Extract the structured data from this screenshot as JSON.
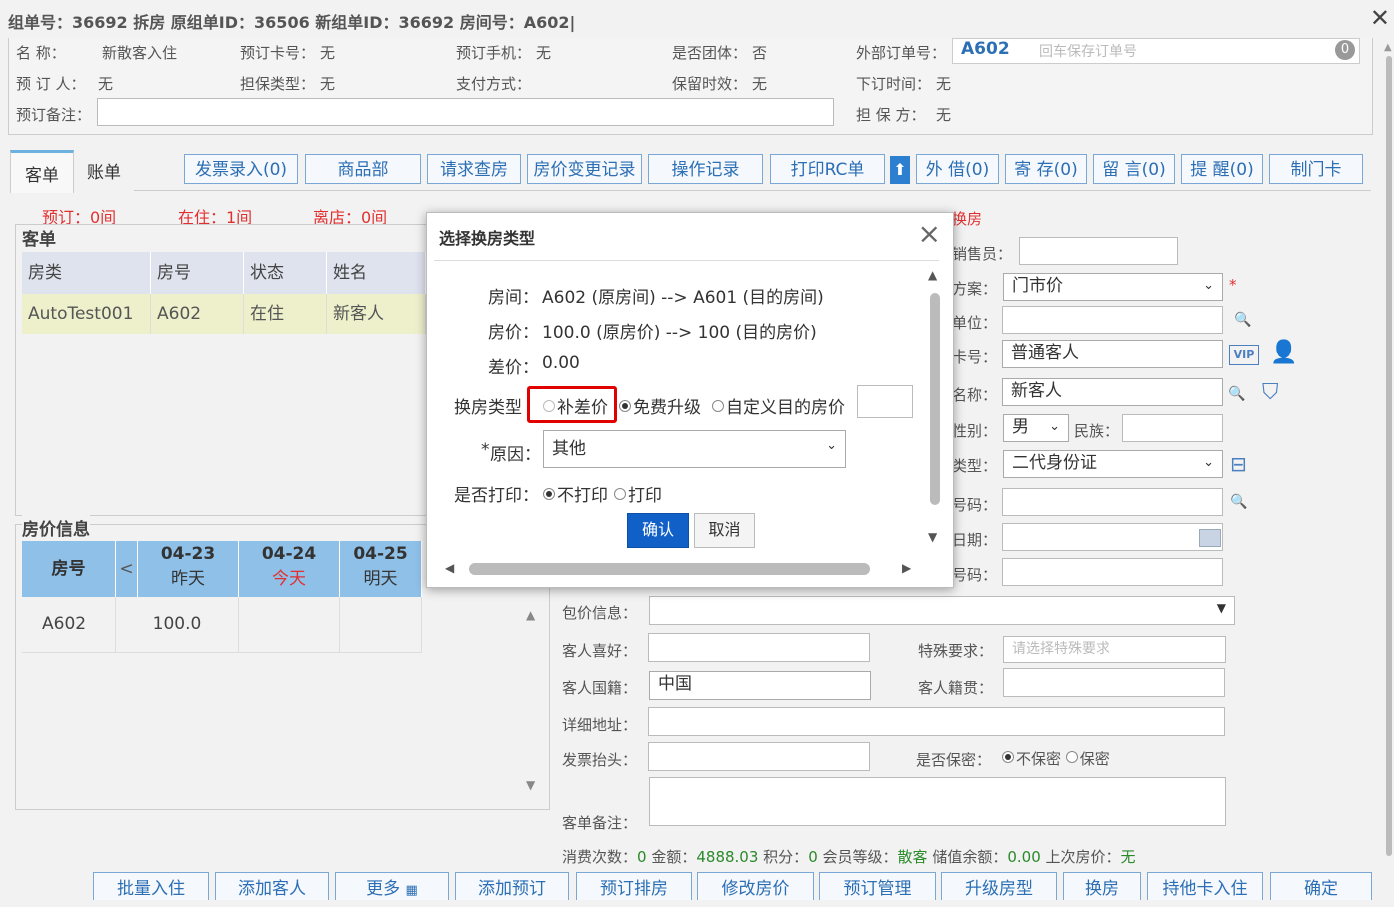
{
  "header": {
    "title": "组单号：36692   拆房 原组单ID：36506 新组单ID：36692 房间号：A602|"
  },
  "info": {
    "name_label": "名      称：",
    "name_value": "新散客入住",
    "card_label": "预订卡号：",
    "card_value": "无",
    "phone_label": "预订手机：",
    "phone_value": "无",
    "group_label": "是否团体：",
    "group_value": "否",
    "ext_label": "外部订单号：",
    "ext_value": "A602",
    "ext_placeholder": "回车保存订单号",
    "ext_count": "0",
    "booker_label": "预 订 人：",
    "booker_value": "无",
    "guarantee_type_label": "担保类型：",
    "guarantee_type_value": "无",
    "pay_label": "支付方式：",
    "pay_value": "",
    "keep_label": "保留时效：",
    "keep_value": "无",
    "order_time_label": "下订时间：",
    "order_time_value": "无",
    "remark_label": "预订备注：",
    "guarantor_label": "担 保 方：",
    "guarantor_value": "无"
  },
  "tabs": [
    "客单",
    "账单"
  ],
  "toolbar": [
    "发票录入(0)",
    "商品部",
    "请求查房",
    "房价变更记录",
    "操作记录",
    "打印RC单",
    "外 借(0)",
    "寄 存(0)",
    "留 言(0)",
    "提 醒(0)",
    "制门卡"
  ],
  "toolbar_up_icon": "arrow-up-icon",
  "stats": {
    "booked": "预订：0间",
    "in_house": "在住：1间",
    "left": "离店：0间"
  },
  "guest_section": {
    "title": "客单",
    "columns": [
      "房类",
      "房号",
      "状态",
      "姓名"
    ],
    "rows": [
      [
        "AutoTest001",
        "A602",
        "在住",
        "新客人"
      ]
    ]
  },
  "price_section": {
    "title": "房价信息",
    "room_col": "房号",
    "prev": "<",
    "dates": [
      {
        "date": "04-23",
        "label": "昨天"
      },
      {
        "date": "04-24",
        "label": "今天"
      },
      {
        "date": "04-25",
        "label": "明天"
      }
    ],
    "rows": [
      {
        "room": "A602",
        "price": "100.0"
      }
    ]
  },
  "form": {
    "change_room": "换房",
    "seller_label": "销售员：",
    "plan_label": "方案：",
    "plan_value": "门市价",
    "unit_label": "单位：",
    "card_label": "卡号：",
    "card_value": "普通客人",
    "vip": "VIP",
    "name_label": "名称：",
    "name_value": "新客人",
    "gender_label": "性别：",
    "gender_value": "男",
    "ethnic_label": "民族：",
    "idtype_label": "类型：",
    "idtype_value": "二代身份证",
    "idno_label": "号码：",
    "date_label": "日期：",
    "num_label": "号码：",
    "package_label": "包价信息：",
    "pref_label": "客人喜好：",
    "special_label": "特殊要求：",
    "special_placeholder": "请选择特殊要求",
    "nation_label": "客人国籍：",
    "nation_value": "中国",
    "native_label": "客人籍贯：",
    "addr_label": "详细地址：",
    "invoice_label": "发票抬头：",
    "secret_label": "是否保密：",
    "secret_no": "不保密",
    "secret_yes": "保密",
    "remark_label": "客单备注："
  },
  "summary": {
    "t1": "消费次数：",
    "v1": "0",
    "t2": "金额：",
    "v2": "4888.03",
    "t3": "积分：",
    "v3": "0",
    "t4": "会员等级：",
    "v4": "散客",
    "t5": "储值余额：",
    "v5": "0.00",
    "t6": "上次房价：",
    "v6": "无"
  },
  "bottom_buttons": [
    "批量入住",
    "添加客人",
    "更多",
    "添加预订",
    "预订排房",
    "修改房价",
    "预订管理",
    "升级房型",
    "换房",
    "持他卡入住",
    "确定"
  ],
  "dialog": {
    "title": "选择换房类型",
    "room_label": "房间：",
    "room_value": "A602 (原房间) --> A601 (目的房间)",
    "price_label": "房价：",
    "price_value": "100.0 (原房价) --> 100 (目的房价)",
    "diff_label": "差价：",
    "diff_value": "0.00",
    "type_label": "换房类型",
    "type_options": [
      "补差价",
      "免费升级",
      "自定义目的房价"
    ],
    "reason_star": "*",
    "reason_label": "原因：",
    "reason_value": "其他",
    "print_label": "是否打印：",
    "print_options": [
      "不打印",
      "打印"
    ],
    "ok": "确认",
    "cancel": "取消"
  }
}
